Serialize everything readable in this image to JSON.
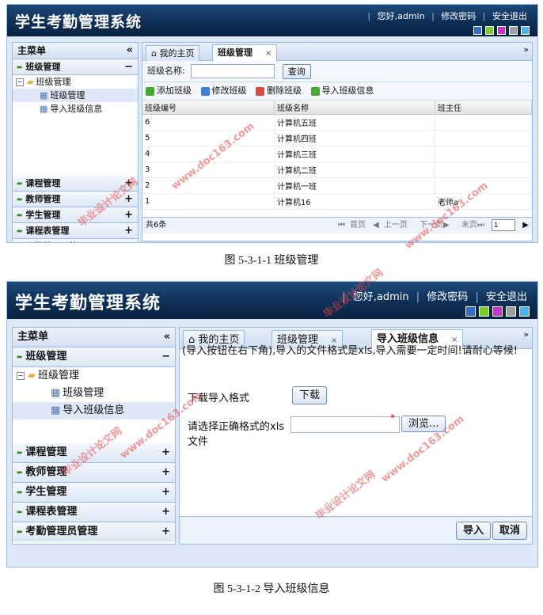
{
  "app_title": "学生考勤管理系统",
  "header_links": {
    "greeting": "您好,admin",
    "change_password": "修改密码",
    "logout": "安全退出"
  },
  "theme_swatches": [
    "#2f6fc9",
    "#7ccc2a",
    "#cc33cc",
    "#a0a0a0",
    "#48b6ee"
  ],
  "sidebar": {
    "title": "主菜单",
    "collapse_icon": "«",
    "sections": [
      {
        "label": "班级管理",
        "toggle": "−"
      },
      {
        "label": "课程管理",
        "toggle": "+"
      },
      {
        "label": "教师管理",
        "toggle": "+"
      },
      {
        "label": "学生管理",
        "toggle": "+"
      },
      {
        "label": "课程表管理",
        "toggle": "+"
      },
      {
        "label": "考勤管理员管理",
        "toggle": "+"
      }
    ],
    "tree": {
      "root": "班级管理",
      "children": [
        "班级管理",
        "导入班级信息"
      ]
    }
  },
  "tabs": {
    "home": "我的主页",
    "class_mgmt": "班级管理",
    "import": "导入班级信息",
    "close": "×",
    "more": "»"
  },
  "screen1": {
    "search_label": "班级名称:",
    "search_button": "查询",
    "toolbar": [
      "添加班级",
      "修改班级",
      "删除班级",
      "导入班级信息"
    ],
    "columns": [
      "班级编号",
      "班级名称",
      "班主任"
    ],
    "rows": [
      [
        "6",
        "计算机五班",
        ""
      ],
      [
        "5",
        "计算机四班",
        ""
      ],
      [
        "4",
        "计算机三班",
        ""
      ],
      [
        "3",
        "计算机二班",
        ""
      ],
      [
        "2",
        "计算机一班",
        ""
      ],
      [
        "1",
        "计算机16",
        "老师a"
      ]
    ],
    "pager": {
      "total": "共6条",
      "first": "首页",
      "prev": "上一页",
      "next": "下一页",
      "last": "末页",
      "page": "1"
    },
    "caption": "图 5-3-1-1  班级管理"
  },
  "screen2": {
    "notice": "(导入按钮在右下角),导入的文件格式是xls,导入需要一定时间!请耐心等候!",
    "download_label": "下载导入格式",
    "download_button": "下载",
    "file_label_1": "请选择正确格式的xls",
    "file_label_2": "文件",
    "required_mark": "*",
    "browse_button": "浏览...",
    "import_button": "导入",
    "cancel_button": "取消",
    "caption": "图 5-3-1-2  导入班级信息"
  },
  "watermark": {
    "line1": "毕业设计论文网",
    "line2": "www.doc163.com"
  }
}
